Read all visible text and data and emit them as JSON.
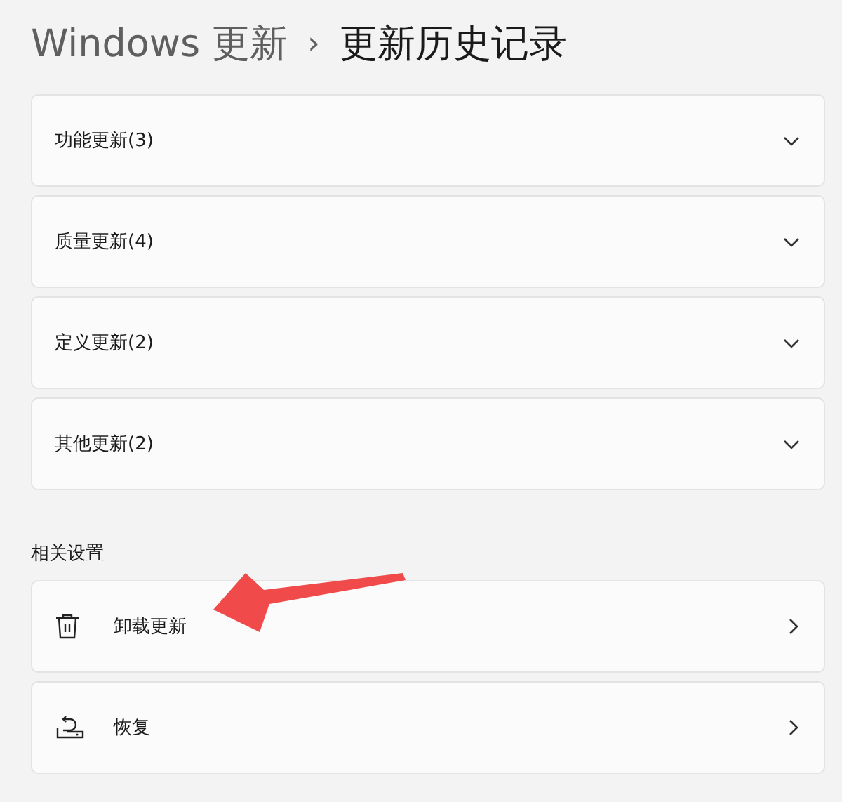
{
  "breadcrumb": {
    "parent": "Windows 更新",
    "separator": "›",
    "current": "更新历史记录"
  },
  "sections": [
    {
      "label": "功能更新(3)",
      "expanded": false
    },
    {
      "label": "质量更新(4)",
      "expanded": false
    },
    {
      "label": "定义更新(2)",
      "expanded": false
    },
    {
      "label": "其他更新(2)",
      "expanded": false
    }
  ],
  "related": {
    "heading": "相关设置",
    "items": [
      {
        "label": "卸载更新",
        "kind": "trash"
      },
      {
        "label": "恢复",
        "kind": "restore"
      }
    ]
  },
  "annotation": {
    "kind": "arrow",
    "color": "#f04a4a"
  }
}
